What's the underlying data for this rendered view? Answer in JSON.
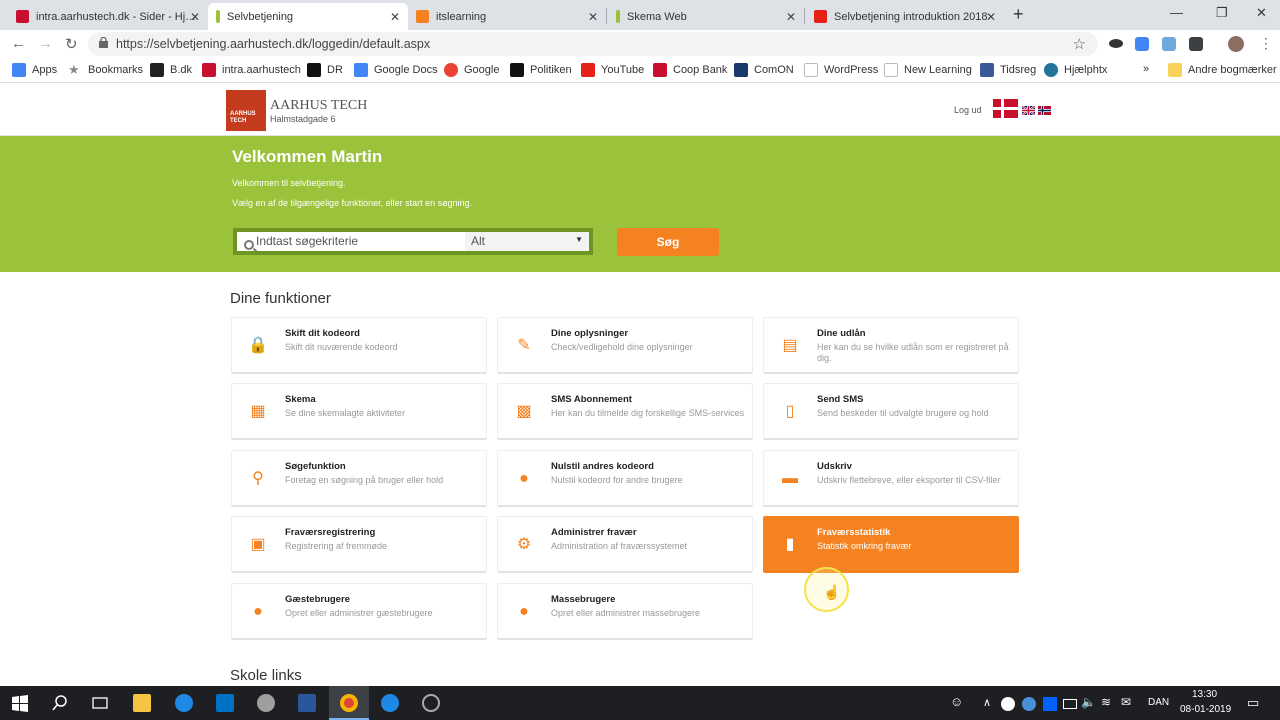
{
  "browser": {
    "tabs": [
      {
        "title": "intra.aarhustech.dk - Sider - Hjem",
        "color": "#c8102e"
      },
      {
        "title": "Selvbetjening",
        "color": "#9ac33b"
      },
      {
        "title": "itslearning",
        "color": "#f58220"
      },
      {
        "title": "Skema Web",
        "color": "#9ac33b"
      },
      {
        "title": "Selvbetjening introduktion 2018",
        "color": "#e62117"
      }
    ],
    "url": "https://selvbetjening.aarhustech.dk/loggedin/default.aspx",
    "bookmarks": [
      {
        "label": "Apps",
        "color": "#4285f4"
      },
      {
        "label": "Bookmarks",
        "color": "#888888"
      },
      {
        "label": "B.dk",
        "color": "#222222"
      },
      {
        "label": "intra.aarhustech",
        "color": "#c8102e"
      },
      {
        "label": "DR",
        "color": "#111111"
      },
      {
        "label": "Google Docs",
        "color": "#4285f4"
      },
      {
        "label": "Google",
        "color": "#ea4335"
      },
      {
        "label": "Politiken",
        "color": "#111111"
      },
      {
        "label": "YouTube",
        "color": "#e62117"
      },
      {
        "label": "Coop Bank",
        "color": "#c8102e"
      },
      {
        "label": "ComON",
        "color": "#1a3a6b"
      },
      {
        "label": "WordPress",
        "color": "#555555"
      },
      {
        "label": "New Learning",
        "color": "#555555"
      },
      {
        "label": "Tidsreg",
        "color": "#3b5998"
      },
      {
        "label": "Hjælphtx",
        "color": "#21759b"
      }
    ],
    "bookmarks_more": "»",
    "other_bookmarks": "Andre bogmærker"
  },
  "site": {
    "logo_text_1": "AARHUS",
    "logo_text_2": "TECH",
    "brand": "AARHUS TECH",
    "address": "Halmstadgade 6",
    "logout": "Log ud"
  },
  "banner": {
    "title": "Velkommen Martin",
    "line1": "Velkommen til selvbetjening.",
    "line2": "Vælg en af de tilgængelige funktioner, eller start en søgning.",
    "search_placeholder": "Indtast søgekriterie",
    "select_value": "Alt",
    "search_button": "Søg"
  },
  "functions_title": "Dine funktioner",
  "functions": [
    {
      "title": "Skift dit kodeord",
      "desc": "Skift dit nuværende kodeord",
      "icon": "lock-icon",
      "glyph": "🔒"
    },
    {
      "title": "Dine oplysninger",
      "desc": "Check/vedligehold dine oplysninger",
      "icon": "edit-document-icon",
      "glyph": "✎"
    },
    {
      "title": "Dine udlån",
      "desc": "Her kan du se hvilke udlån som er registreret på dig.",
      "icon": "book-icon",
      "glyph": "▤"
    },
    {
      "title": "Skema",
      "desc": "Se dine skemalagte aktiviteter",
      "icon": "calendar-grid-icon",
      "glyph": "▦"
    },
    {
      "title": "SMS Abonnement",
      "desc": "Her kan du tilmelde dig forskellige SMS-services",
      "icon": "sms-subscription-icon",
      "glyph": "▩"
    },
    {
      "title": "Send SMS",
      "desc": "Send beskeder til udvalgte brugere og hold",
      "icon": "mobile-phone-icon",
      "glyph": "▯"
    },
    {
      "title": "Søgefunktion",
      "desc": "Foretag en søgning på bruger eller hold",
      "icon": "search-icon",
      "glyph": "⚲"
    },
    {
      "title": "Nulstil andres kodeord",
      "desc": "Nulstil kodeord for andre brugere",
      "icon": "user-key-icon",
      "glyph": "●"
    },
    {
      "title": "Udskriv",
      "desc": "Udskriv flettebreve, eller eksporter til CSV-filer",
      "icon": "printer-icon",
      "glyph": "▬"
    },
    {
      "title": "Fraværsregistrering",
      "desc": "Registrering af fremmøde",
      "icon": "clipboard-icon",
      "glyph": "▣"
    },
    {
      "title": "Administrer fravær",
      "desc": "Administration af fraværssystemet",
      "icon": "gear-list-icon",
      "glyph": "⚙"
    },
    {
      "title": "Fraværsstatistik",
      "desc": "Statistik omkring fravær",
      "icon": "bar-chart-icon",
      "glyph": "▮"
    },
    {
      "title": "Gæstebrugere",
      "desc": "Opret eller administrer gæstebrugere",
      "icon": "guest-user-icon",
      "glyph": "●"
    },
    {
      "title": "Massebrugere",
      "desc": "Opret eller administrer massebrugere",
      "icon": "users-group-icon",
      "glyph": "●"
    }
  ],
  "links_title": "Skole links",
  "taskbar": {
    "language": "DAN",
    "time": "13:30",
    "date": "08-01-2019"
  }
}
